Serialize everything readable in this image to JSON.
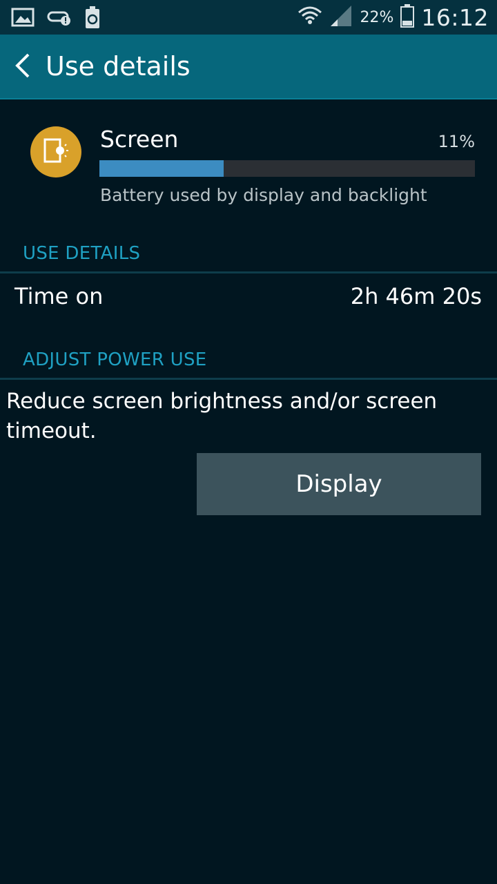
{
  "status_bar": {
    "left_icons": [
      "gallery-icon",
      "link-alert-icon",
      "battery-saver-icon"
    ],
    "right_icons": [
      "wifi-icon",
      "signal-icon",
      "battery-icon"
    ],
    "battery_percent": "22%",
    "time": "16:12"
  },
  "header": {
    "title": "Use details",
    "back_icon": "chevron-left-icon"
  },
  "usage": {
    "app_name": "Screen",
    "percent_label": "11%",
    "percent_value": 0.33,
    "description": "Battery used by display and backlight",
    "icon": "screen-brightness-icon",
    "icon_color": "#d9a12a",
    "bar_fill_color": "#3c8cc1"
  },
  "use_details": {
    "header": "USE DETAILS",
    "time_on_label": "Time on",
    "time_on_value": "2h 46m 20s"
  },
  "adjust_power": {
    "header": "ADJUST POWER USE",
    "advice": "Reduce screen brightness and/or screen timeout.",
    "button_label": "Display"
  },
  "colors": {
    "background": "#011620",
    "action_bar": "#06677c",
    "section_text": "#1fa1c3",
    "button": "#3c535c"
  }
}
